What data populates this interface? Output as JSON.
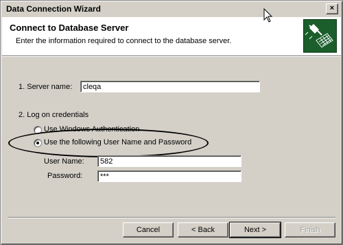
{
  "window": {
    "title": "Data Connection Wizard",
    "close_label": "×"
  },
  "header": {
    "title": "Connect to Database Server",
    "subtitle": "Enter the information required to connect to the database server.",
    "icon": "plug-keyboard-icon"
  },
  "form": {
    "server_section": "1. Server name:",
    "server_value": "cleqa",
    "credentials_section": "2. Log on credentials",
    "options": [
      {
        "label": "Use Windows Authentication",
        "selected": false
      },
      {
        "label": "Use the following User Name and Password",
        "selected": true
      }
    ],
    "username_label": "User Name:",
    "username_value": "582",
    "password_label": "Password:",
    "password_value": "***"
  },
  "buttons": {
    "cancel": "Cancel",
    "back": "< Back",
    "next": "Next >",
    "finish": "Finish"
  }
}
